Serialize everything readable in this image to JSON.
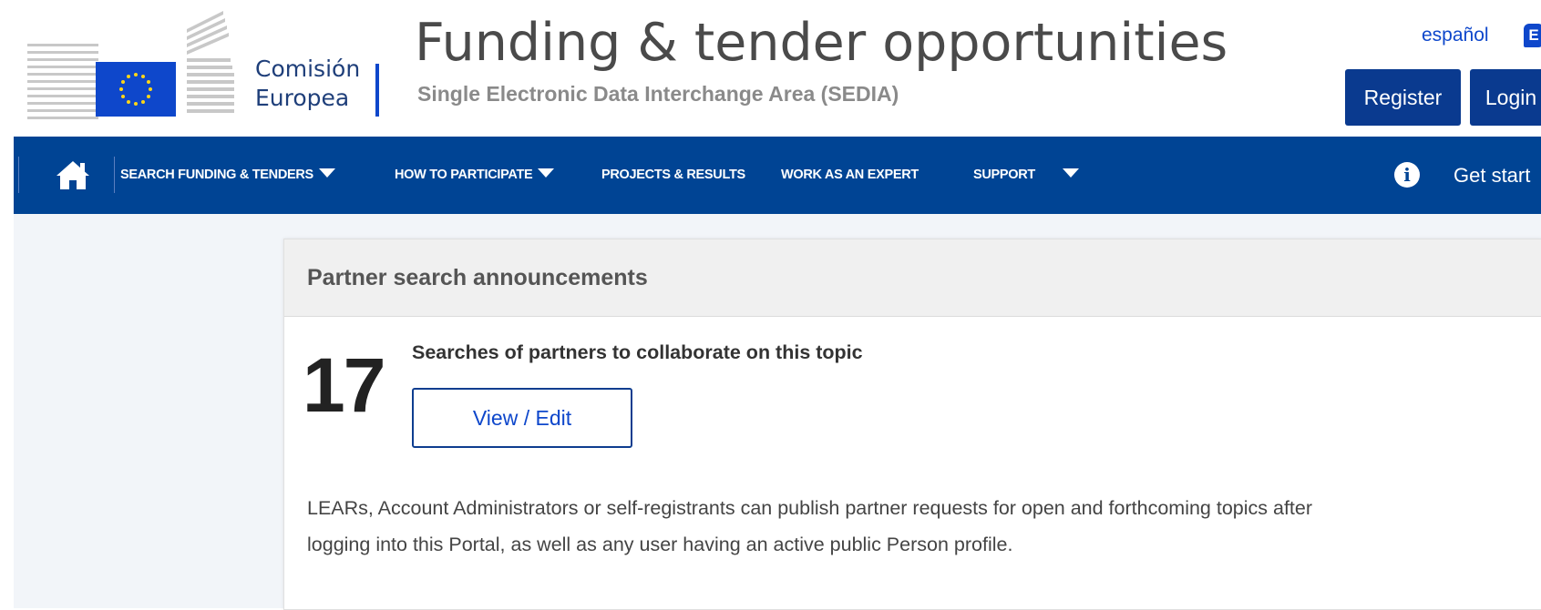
{
  "header": {
    "logo_line1": "Comisión",
    "logo_line2": "Europea",
    "title": "Funding & tender opportunities",
    "subtitle": "Single Electronic Data Interchange Area (SEDIA)",
    "language": "español",
    "language_badge": "E",
    "register_label": "Register",
    "login_label": "Login"
  },
  "nav": {
    "home_icon": "home-icon",
    "items": [
      {
        "label": "SEARCH FUNDING & TENDERS",
        "dropdown": true
      },
      {
        "label": "HOW TO PARTICIPATE",
        "dropdown": true
      },
      {
        "label": "PROJECTS & RESULTS",
        "dropdown": false
      },
      {
        "label": "WORK AS AN EXPERT",
        "dropdown": false
      },
      {
        "label": "SUPPORT",
        "dropdown": true
      }
    ],
    "info_icon_glyph": "i",
    "get_started_label": "Get start"
  },
  "panel": {
    "title": "Partner search announcements",
    "count": "17",
    "searches_text": "Searches of partners to collaborate on this topic",
    "view_edit_label": "View / Edit",
    "info_line1": "LEARs, Account Administrators or self-registrants can publish partner requests for open and forthcoming topics after",
    "info_line2": "logging into this Portal, as well as any user having an active public Person profile."
  },
  "colors": {
    "brand_blue": "#004494",
    "button_blue": "#0a3a8f",
    "link_blue": "#0e47cb",
    "page_background": "#f2f5f9"
  }
}
